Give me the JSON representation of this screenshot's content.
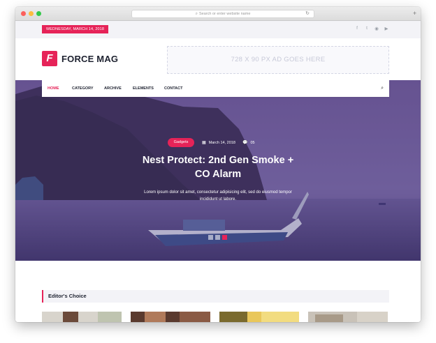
{
  "browser": {
    "url_placeholder": "Search or enter website name",
    "search_glyph": "⌕",
    "reload_glyph": "↻",
    "newtab_glyph": "+"
  },
  "topbar": {
    "date": "WEDNESDAY, MARCH 14, 2018",
    "socials": [
      {
        "name": "facebook-icon",
        "glyph": "f"
      },
      {
        "name": "twitter-icon",
        "glyph": "t"
      },
      {
        "name": "pinterest-icon",
        "glyph": "◉"
      },
      {
        "name": "youtube-icon",
        "glyph": "▶"
      }
    ]
  },
  "header": {
    "logo_glyph": "F",
    "logo_text": "FORCE MAG",
    "ad_text": "728 X 90 PX AD GOES HERE"
  },
  "nav": {
    "items": [
      "HOME",
      "CATEGORY",
      "ARCHIVE",
      "ELEMENTS",
      "CONTACT"
    ],
    "active_index": 0,
    "search_glyph": "⌕"
  },
  "hero": {
    "tag": "Gadgets",
    "date": "March 14, 2018",
    "comments": "05",
    "date_glyph": "▦",
    "comments_glyph": "💬",
    "title": "Nest Protect: 2nd Gen Smoke + CO Alarm",
    "excerpt": "Lorem ipsum dolor sit amet, consectetur adipisicing elit, sed do eiusmod tempor incididunt ut labore.",
    "slides_total": 3,
    "slide_active": 3
  },
  "editors_choice": {
    "title": "Editor's Choice"
  },
  "colors": {
    "accent": "#e62358",
    "dark": "#1e2230",
    "hero_overlay": "#5c4a86"
  }
}
